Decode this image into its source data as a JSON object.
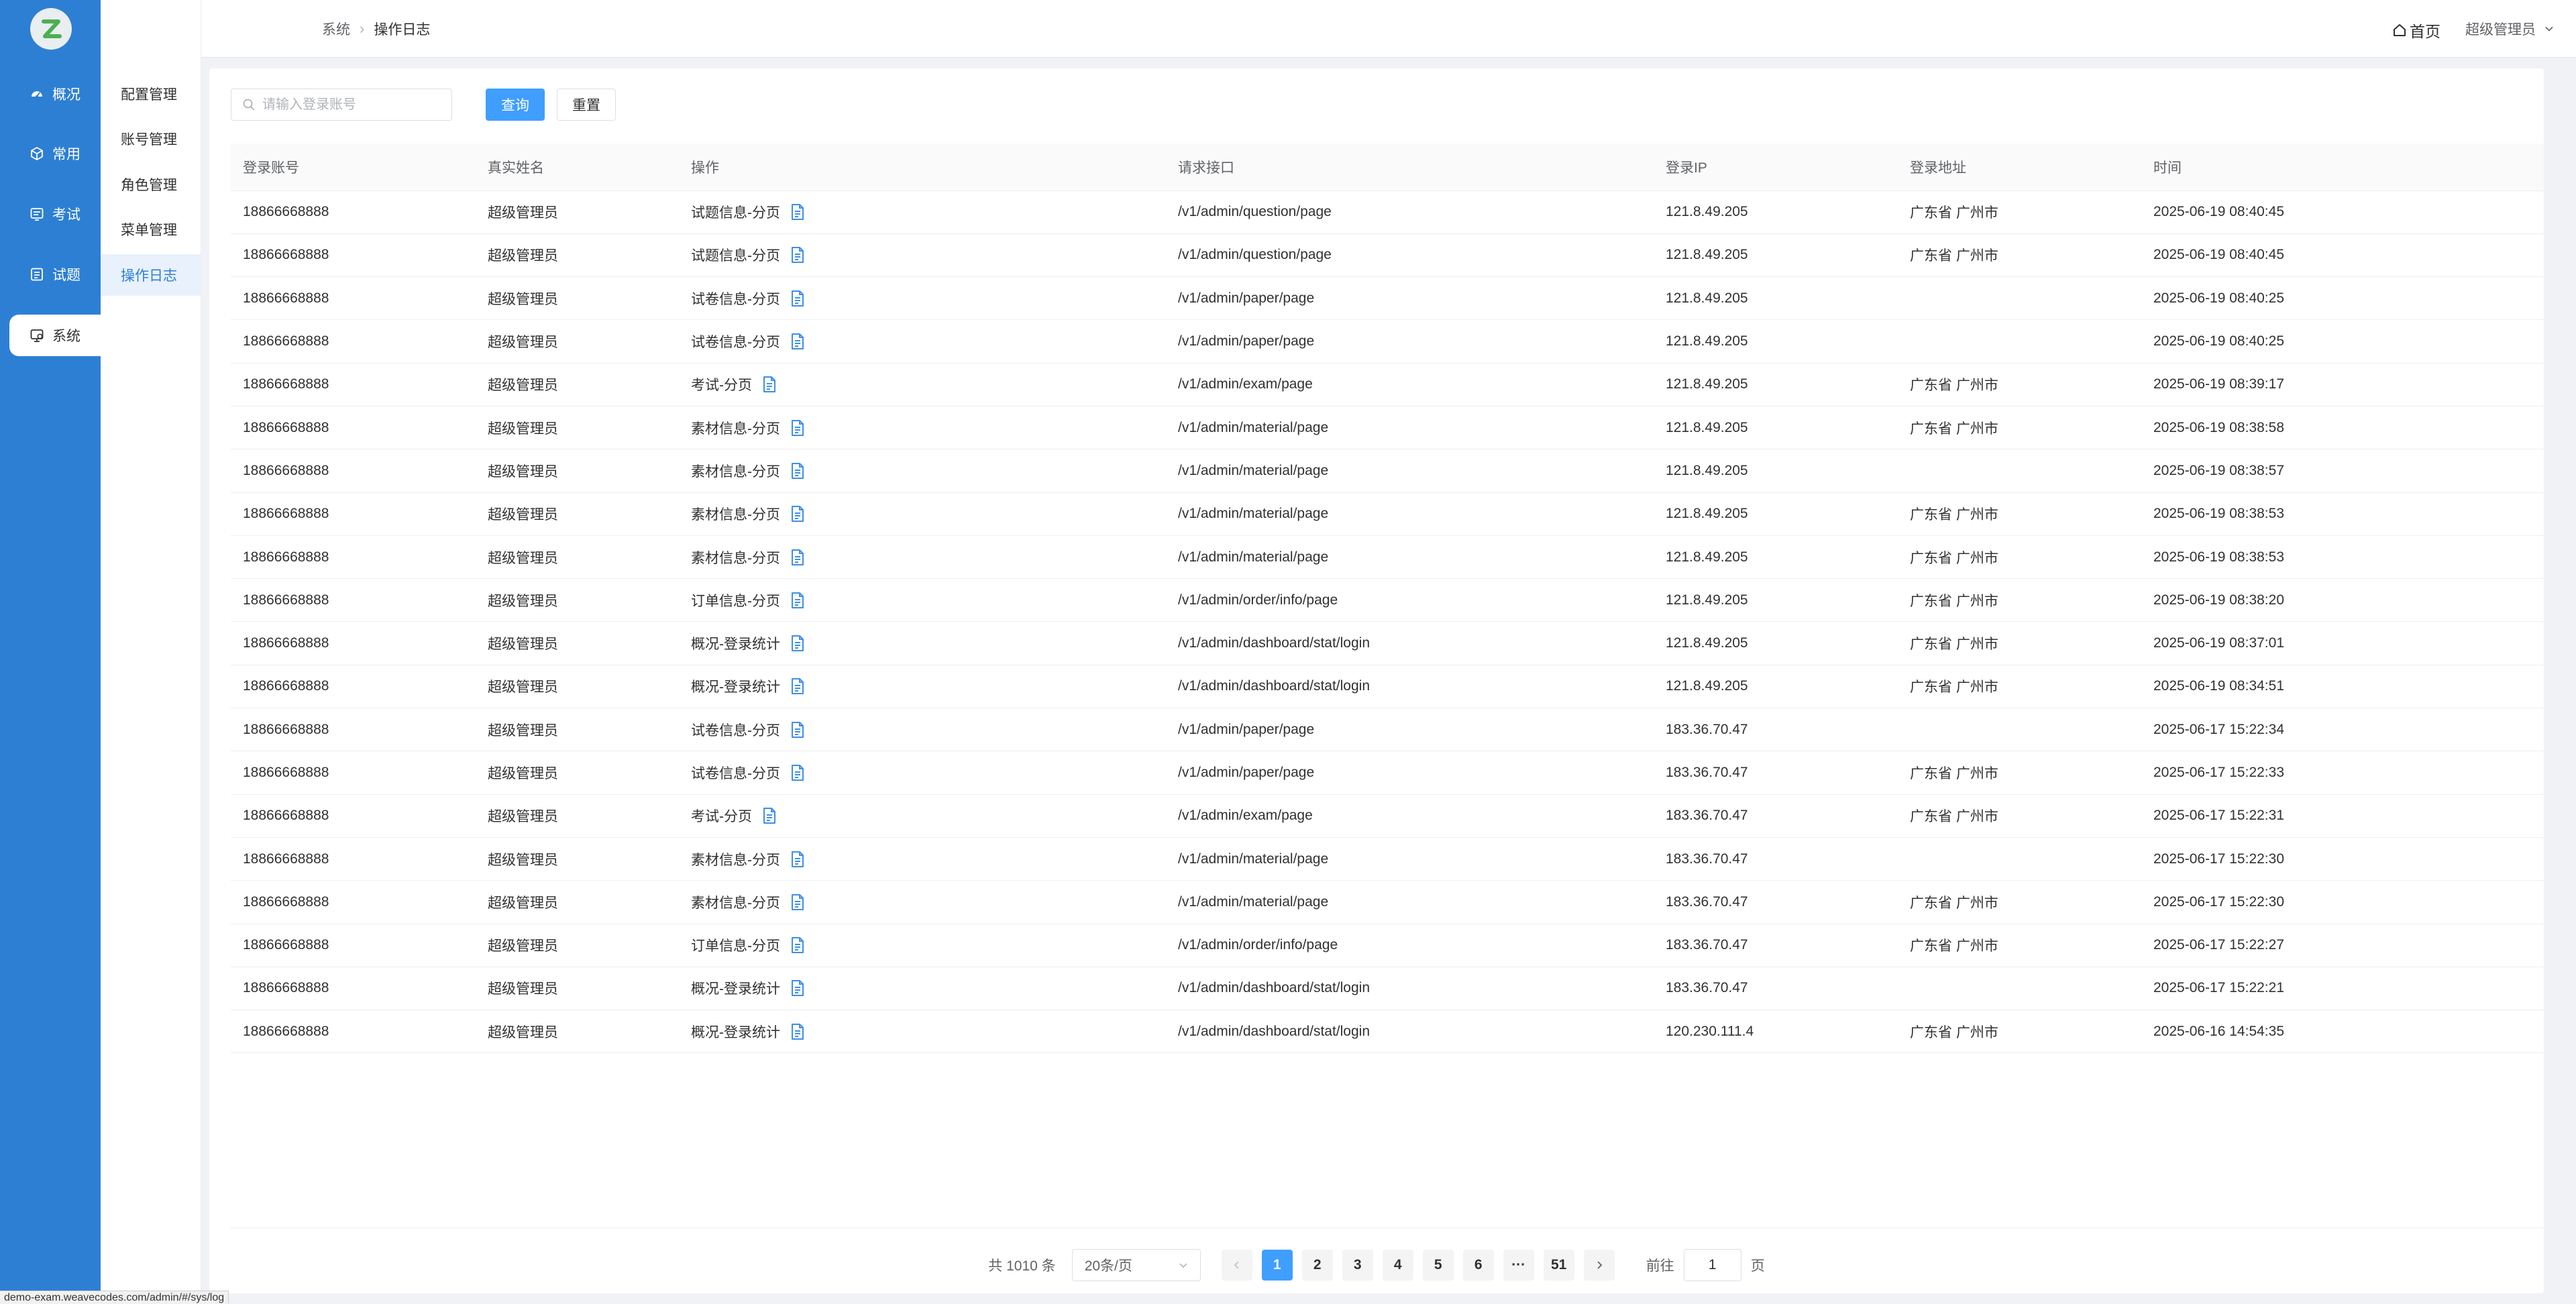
{
  "rail": {
    "items": [
      {
        "label": "概况",
        "icon": "dashboard-icon"
      },
      {
        "label": "常用",
        "icon": "cube-icon"
      },
      {
        "label": "考试",
        "icon": "exam-icon"
      },
      {
        "label": "试题",
        "icon": "question-icon"
      },
      {
        "label": "系统",
        "icon": "system-icon"
      }
    ],
    "active": "系统"
  },
  "submenu": {
    "items": [
      "配置管理",
      "账号管理",
      "角色管理",
      "菜单管理",
      "操作日志"
    ],
    "active": "操作日志"
  },
  "header": {
    "breadcrumb": [
      "系统",
      "操作日志"
    ],
    "home_label": "首页",
    "user_label": "超级管理员"
  },
  "filters": {
    "search_placeholder": "请输入登录账号",
    "search_value": "",
    "query_label": "查询",
    "reset_label": "重置"
  },
  "table": {
    "columns": [
      "登录账号",
      "真实姓名",
      "操作",
      "请求接口",
      "登录IP",
      "登录地址",
      "时间"
    ],
    "rows": [
      [
        "18866668888",
        "超级管理员",
        "试题信息-分页",
        "/v1/admin/question/page",
        "121.8.49.205",
        "广东省 广州市",
        "2025-06-19 08:40:45"
      ],
      [
        "18866668888",
        "超级管理员",
        "试题信息-分页",
        "/v1/admin/question/page",
        "121.8.49.205",
        "广东省 广州市",
        "2025-06-19 08:40:45"
      ],
      [
        "18866668888",
        "超级管理员",
        "试卷信息-分页",
        "/v1/admin/paper/page",
        "121.8.49.205",
        "",
        "2025-06-19 08:40:25"
      ],
      [
        "18866668888",
        "超级管理员",
        "试卷信息-分页",
        "/v1/admin/paper/page",
        "121.8.49.205",
        "",
        "2025-06-19 08:40:25"
      ],
      [
        "18866668888",
        "超级管理员",
        "考试-分页",
        "/v1/admin/exam/page",
        "121.8.49.205",
        "广东省 广州市",
        "2025-06-19 08:39:17"
      ],
      [
        "18866668888",
        "超级管理员",
        "素材信息-分页",
        "/v1/admin/material/page",
        "121.8.49.205",
        "广东省 广州市",
        "2025-06-19 08:38:58"
      ],
      [
        "18866668888",
        "超级管理员",
        "素材信息-分页",
        "/v1/admin/material/page",
        "121.8.49.205",
        "",
        "2025-06-19 08:38:57"
      ],
      [
        "18866668888",
        "超级管理员",
        "素材信息-分页",
        "/v1/admin/material/page",
        "121.8.49.205",
        "广东省 广州市",
        "2025-06-19 08:38:53"
      ],
      [
        "18866668888",
        "超级管理员",
        "素材信息-分页",
        "/v1/admin/material/page",
        "121.8.49.205",
        "广东省 广州市",
        "2025-06-19 08:38:53"
      ],
      [
        "18866668888",
        "超级管理员",
        "订单信息-分页",
        "/v1/admin/order/info/page",
        "121.8.49.205",
        "广东省 广州市",
        "2025-06-19 08:38:20"
      ],
      [
        "18866668888",
        "超级管理员",
        "概况-登录统计",
        "/v1/admin/dashboard/stat/login",
        "121.8.49.205",
        "广东省 广州市",
        "2025-06-19 08:37:01"
      ],
      [
        "18866668888",
        "超级管理员",
        "概况-登录统计",
        "/v1/admin/dashboard/stat/login",
        "121.8.49.205",
        "广东省 广州市",
        "2025-06-19 08:34:51"
      ],
      [
        "18866668888",
        "超级管理员",
        "试卷信息-分页",
        "/v1/admin/paper/page",
        "183.36.70.47",
        "",
        "2025-06-17 15:22:34"
      ],
      [
        "18866668888",
        "超级管理员",
        "试卷信息-分页",
        "/v1/admin/paper/page",
        "183.36.70.47",
        "广东省 广州市",
        "2025-06-17 15:22:33"
      ],
      [
        "18866668888",
        "超级管理员",
        "考试-分页",
        "/v1/admin/exam/page",
        "183.36.70.47",
        "广东省 广州市",
        "2025-06-17 15:22:31"
      ],
      [
        "18866668888",
        "超级管理员",
        "素材信息-分页",
        "/v1/admin/material/page",
        "183.36.70.47",
        "",
        "2025-06-17 15:22:30"
      ],
      [
        "18866668888",
        "超级管理员",
        "素材信息-分页",
        "/v1/admin/material/page",
        "183.36.70.47",
        "广东省 广州市",
        "2025-06-17 15:22:30"
      ],
      [
        "18866668888",
        "超级管理员",
        "订单信息-分页",
        "/v1/admin/order/info/page",
        "183.36.70.47",
        "广东省 广州市",
        "2025-06-17 15:22:27"
      ],
      [
        "18866668888",
        "超级管理员",
        "概况-登录统计",
        "/v1/admin/dashboard/stat/login",
        "183.36.70.47",
        "",
        "2025-06-17 15:22:21"
      ],
      [
        "18866668888",
        "超级管理员",
        "概况-登录统计",
        "/v1/admin/dashboard/stat/login",
        "120.230.111.4",
        "广东省 广州市",
        "2025-06-16 14:54:35"
      ]
    ]
  },
  "pagination": {
    "total_label": "共 1010 条",
    "page_size_label": "20条/页",
    "pages": [
      "1",
      "2",
      "3",
      "4",
      "5",
      "6",
      "···",
      "51"
    ],
    "current_page": "1",
    "goto_label": "前往",
    "goto_value": "1",
    "page_suffix": "页"
  },
  "status_bar": {
    "url": "demo-exam.weavecodes.com/admin/#/sys/log"
  },
  "colors": {
    "rail_bg": "#2d7fd4",
    "primary": "#409eff",
    "doc_icon": "#3f8fe6"
  }
}
